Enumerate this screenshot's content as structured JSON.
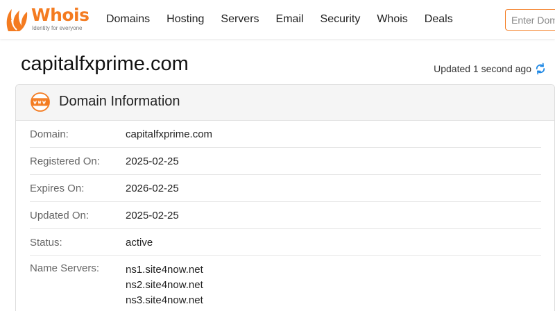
{
  "brand": {
    "name": "Whois",
    "tagline": "Identity for everyone",
    "color": "#f47b20"
  },
  "nav": {
    "items": [
      "Domains",
      "Hosting",
      "Servers",
      "Email",
      "Security",
      "Whois",
      "Deals"
    ]
  },
  "search": {
    "placeholder": "Enter Domain"
  },
  "page": {
    "title": "capitalfxprime.com",
    "updated": "Updated 1 second ago",
    "refresh_icon": "refresh-icon",
    "refresh_color": "#1e88e5"
  },
  "card": {
    "icon": "www-icon",
    "title": "Domain Information",
    "rows": [
      {
        "label": "Domain:",
        "value": "capitalfxprime.com"
      },
      {
        "label": "Registered On:",
        "value": "2025-02-25"
      },
      {
        "label": "Expires On:",
        "value": "2026-02-25"
      },
      {
        "label": "Updated On:",
        "value": "2025-02-25"
      },
      {
        "label": "Status:",
        "value": "active"
      }
    ],
    "name_servers": {
      "label": "Name Servers:",
      "values": [
        "ns1.site4now.net",
        "ns2.site4now.net",
        "ns3.site4now.net"
      ]
    }
  }
}
